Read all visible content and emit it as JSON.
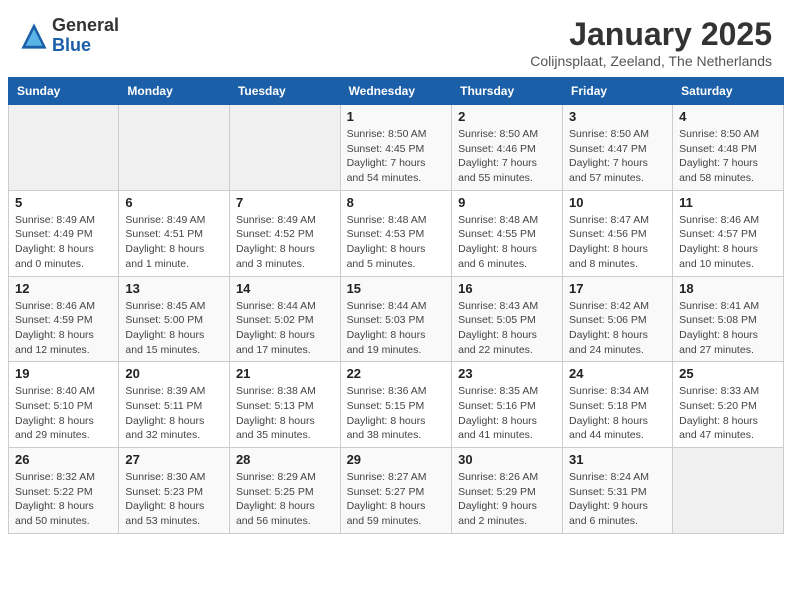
{
  "header": {
    "logo_general": "General",
    "logo_blue": "Blue",
    "title": "January 2025",
    "subtitle": "Colijnsplaat, Zeeland, The Netherlands"
  },
  "weekdays": [
    "Sunday",
    "Monday",
    "Tuesday",
    "Wednesday",
    "Thursday",
    "Friday",
    "Saturday"
  ],
  "weeks": [
    [
      {
        "day": "",
        "info": ""
      },
      {
        "day": "",
        "info": ""
      },
      {
        "day": "",
        "info": ""
      },
      {
        "day": "1",
        "info": "Sunrise: 8:50 AM\nSunset: 4:45 PM\nDaylight: 7 hours\nand 54 minutes."
      },
      {
        "day": "2",
        "info": "Sunrise: 8:50 AM\nSunset: 4:46 PM\nDaylight: 7 hours\nand 55 minutes."
      },
      {
        "day": "3",
        "info": "Sunrise: 8:50 AM\nSunset: 4:47 PM\nDaylight: 7 hours\nand 57 minutes."
      },
      {
        "day": "4",
        "info": "Sunrise: 8:50 AM\nSunset: 4:48 PM\nDaylight: 7 hours\nand 58 minutes."
      }
    ],
    [
      {
        "day": "5",
        "info": "Sunrise: 8:49 AM\nSunset: 4:49 PM\nDaylight: 8 hours\nand 0 minutes."
      },
      {
        "day": "6",
        "info": "Sunrise: 8:49 AM\nSunset: 4:51 PM\nDaylight: 8 hours\nand 1 minute."
      },
      {
        "day": "7",
        "info": "Sunrise: 8:49 AM\nSunset: 4:52 PM\nDaylight: 8 hours\nand 3 minutes."
      },
      {
        "day": "8",
        "info": "Sunrise: 8:48 AM\nSunset: 4:53 PM\nDaylight: 8 hours\nand 5 minutes."
      },
      {
        "day": "9",
        "info": "Sunrise: 8:48 AM\nSunset: 4:55 PM\nDaylight: 8 hours\nand 6 minutes."
      },
      {
        "day": "10",
        "info": "Sunrise: 8:47 AM\nSunset: 4:56 PM\nDaylight: 8 hours\nand 8 minutes."
      },
      {
        "day": "11",
        "info": "Sunrise: 8:46 AM\nSunset: 4:57 PM\nDaylight: 8 hours\nand 10 minutes."
      }
    ],
    [
      {
        "day": "12",
        "info": "Sunrise: 8:46 AM\nSunset: 4:59 PM\nDaylight: 8 hours\nand 12 minutes."
      },
      {
        "day": "13",
        "info": "Sunrise: 8:45 AM\nSunset: 5:00 PM\nDaylight: 8 hours\nand 15 minutes."
      },
      {
        "day": "14",
        "info": "Sunrise: 8:44 AM\nSunset: 5:02 PM\nDaylight: 8 hours\nand 17 minutes."
      },
      {
        "day": "15",
        "info": "Sunrise: 8:44 AM\nSunset: 5:03 PM\nDaylight: 8 hours\nand 19 minutes."
      },
      {
        "day": "16",
        "info": "Sunrise: 8:43 AM\nSunset: 5:05 PM\nDaylight: 8 hours\nand 22 minutes."
      },
      {
        "day": "17",
        "info": "Sunrise: 8:42 AM\nSunset: 5:06 PM\nDaylight: 8 hours\nand 24 minutes."
      },
      {
        "day": "18",
        "info": "Sunrise: 8:41 AM\nSunset: 5:08 PM\nDaylight: 8 hours\nand 27 minutes."
      }
    ],
    [
      {
        "day": "19",
        "info": "Sunrise: 8:40 AM\nSunset: 5:10 PM\nDaylight: 8 hours\nand 29 minutes."
      },
      {
        "day": "20",
        "info": "Sunrise: 8:39 AM\nSunset: 5:11 PM\nDaylight: 8 hours\nand 32 minutes."
      },
      {
        "day": "21",
        "info": "Sunrise: 8:38 AM\nSunset: 5:13 PM\nDaylight: 8 hours\nand 35 minutes."
      },
      {
        "day": "22",
        "info": "Sunrise: 8:36 AM\nSunset: 5:15 PM\nDaylight: 8 hours\nand 38 minutes."
      },
      {
        "day": "23",
        "info": "Sunrise: 8:35 AM\nSunset: 5:16 PM\nDaylight: 8 hours\nand 41 minutes."
      },
      {
        "day": "24",
        "info": "Sunrise: 8:34 AM\nSunset: 5:18 PM\nDaylight: 8 hours\nand 44 minutes."
      },
      {
        "day": "25",
        "info": "Sunrise: 8:33 AM\nSunset: 5:20 PM\nDaylight: 8 hours\nand 47 minutes."
      }
    ],
    [
      {
        "day": "26",
        "info": "Sunrise: 8:32 AM\nSunset: 5:22 PM\nDaylight: 8 hours\nand 50 minutes."
      },
      {
        "day": "27",
        "info": "Sunrise: 8:30 AM\nSunset: 5:23 PM\nDaylight: 8 hours\nand 53 minutes."
      },
      {
        "day": "28",
        "info": "Sunrise: 8:29 AM\nSunset: 5:25 PM\nDaylight: 8 hours\nand 56 minutes."
      },
      {
        "day": "29",
        "info": "Sunrise: 8:27 AM\nSunset: 5:27 PM\nDaylight: 8 hours\nand 59 minutes."
      },
      {
        "day": "30",
        "info": "Sunrise: 8:26 AM\nSunset: 5:29 PM\nDaylight: 9 hours\nand 2 minutes."
      },
      {
        "day": "31",
        "info": "Sunrise: 8:24 AM\nSunset: 5:31 PM\nDaylight: 9 hours\nand 6 minutes."
      },
      {
        "day": "",
        "info": ""
      }
    ]
  ]
}
